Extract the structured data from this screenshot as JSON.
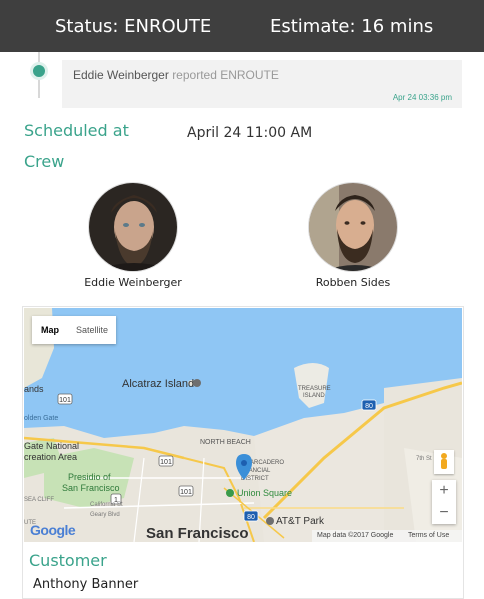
{
  "header": {
    "status": "Status: ENROUTE",
    "estimate": "Estimate: 16 mins"
  },
  "activity": {
    "user": "Eddie Weinberger",
    "action": "reported ENROUTE",
    "timestamp": "Apr 24 03:36 pm"
  },
  "schedule": {
    "label": "Scheduled at",
    "value": "April 24 11:00 AM"
  },
  "crew": {
    "label": "Crew",
    "members": [
      {
        "name": "Eddie Weinberger"
      },
      {
        "name": "Robben Sides"
      }
    ]
  },
  "map": {
    "type_map": "Map",
    "type_satellite": "Satellite",
    "zoom_in": "+",
    "zoom_out": "−",
    "attribution": "Map data ©2017 Google",
    "terms": "Terms of Use",
    "logo": "Google",
    "labels": {
      "alcatraz": "Alcatraz Island",
      "treasure1": "TREASURE",
      "treasure2": "ISLAND",
      "north_beach": "NORTH BEACH",
      "embarcadero": "EMBARCADERO",
      "financial": "FINANCIAL",
      "district": "DISTRICT",
      "union_square": "Union Square",
      "att_park": "AT&T Park",
      "presidio1": "Presidio of",
      "presidio2": "San Francisco",
      "gate_national": "Gate National",
      "recreation": "creation Area",
      "sf": "San Francisco",
      "california": "California St",
      "geary": "Geary Blvd",
      "sea_cliff": "SEA CLIFF",
      "golden_gate": "olden Gate",
      "nds": "ands",
      "seventh": "7th St",
      "ute": "UTE",
      "h101a": "101",
      "h101b": "101",
      "h101c": "101",
      "h80a": "80",
      "h80b": "80",
      "h1": "1"
    }
  },
  "customer": {
    "label": "Customer",
    "name": "Anthony Banner"
  },
  "colors": {
    "accent": "#3aa38b",
    "header_bg": "#3f3f3f"
  }
}
